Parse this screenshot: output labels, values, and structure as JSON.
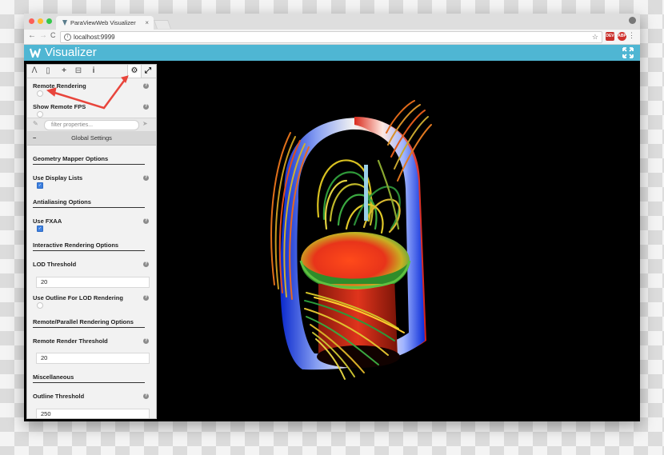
{
  "browser": {
    "tab_title": "ParaViewWeb Visualizer",
    "tab_close": "×",
    "url": "localhost:9999",
    "star": "☆",
    "ext1": "DEV",
    "ext2": "ABP",
    "menu": "⋮",
    "back": "←",
    "forward": "→",
    "reload": "C"
  },
  "app": {
    "title": "Visualizer",
    "accent": "#4fb6d3"
  },
  "toolbar_icons": [
    "pipeline-icon",
    "file-icon",
    "add-icon",
    "save-icon",
    "info-icon",
    "settings-icon",
    "fullscreen-icon"
  ],
  "toolbar_glyphs": [
    "ⴷ",
    "▯",
    "+",
    "⊟",
    "i",
    "⚙",
    "⤢"
  ],
  "panel": {
    "remote_rendering": "Remote Rendering",
    "show_remote_fps": "Show Remote FPS",
    "filter_placeholder": "filter properties...",
    "section": "Global Settings",
    "section_toggle": "−",
    "geometry_title": "Geometry Mapper Options",
    "use_display_lists": "Use Display Lists",
    "antialiasing_title": "Antialiasing Options",
    "use_fxaa": "Use FXAA",
    "interactive_title": "Interactive Rendering Options",
    "lod_threshold": "LOD Threshold",
    "lod_value": "20",
    "use_outline_lod": "Use Outline For LOD Rendering",
    "remote_title": "Remote/Parallel Rendering Options",
    "remote_render_threshold": "Remote Render Threshold",
    "remote_value": "20",
    "misc_title": "Miscellaneous",
    "outline_threshold": "Outline Threshold",
    "outline_value": "250",
    "help": "?"
  }
}
